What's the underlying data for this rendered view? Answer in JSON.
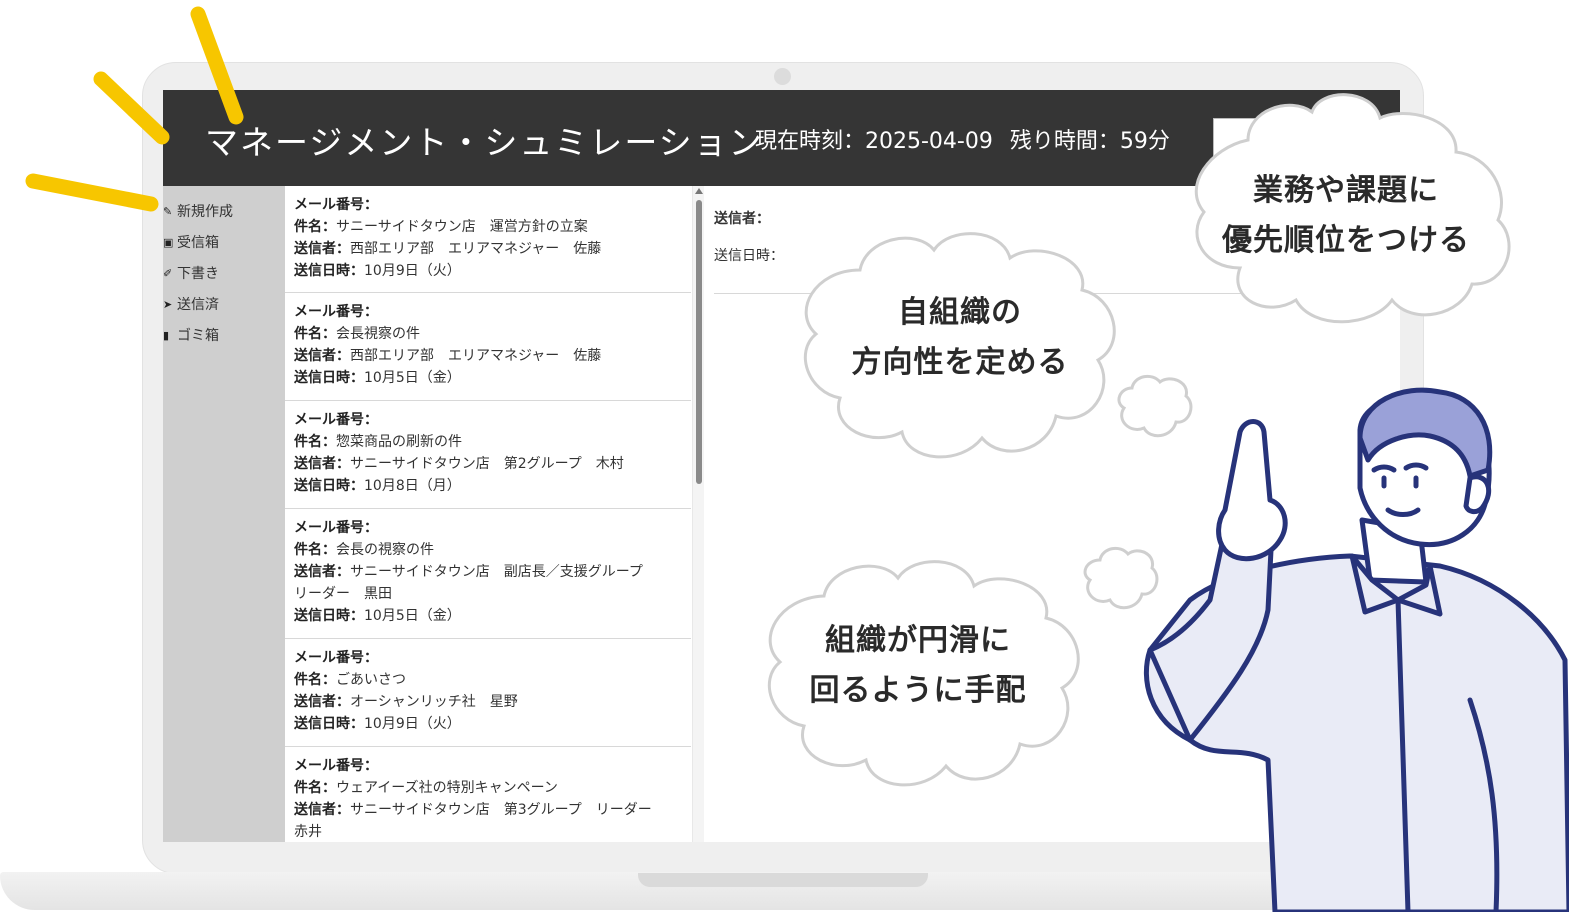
{
  "header": {
    "app_title": "マネージメント・シュミレーション",
    "current_time": "現在時刻：2025-04-09",
    "remaining_time": "残り時間：59分"
  },
  "sidebar": {
    "items": [
      {
        "label": "新規作成",
        "icon": "pencil-square-icon"
      },
      {
        "label": "受信箱",
        "icon": "inbox-icon"
      },
      {
        "label": "下書き",
        "icon": "pencil-icon"
      },
      {
        "label": "送信済",
        "icon": "send-icon"
      },
      {
        "label": "ゴミ箱",
        "icon": "trash-icon"
      }
    ]
  },
  "mail_list": {
    "labels": {
      "number": "メール番号：",
      "subject": "件名：",
      "sender": "送信者：",
      "date": "送信日時："
    },
    "items": [
      {
        "subject": "サニーサイドタウン店　運営方針の立案",
        "sender": "西部エリア部　エリアマネジャー　佐藤",
        "date": "10月9日（火）"
      },
      {
        "subject": "会長視察の件",
        "sender": "西部エリア部　エリアマネジャー　佐藤",
        "date": "10月5日（金）"
      },
      {
        "subject": "惣菜商品の刷新の件",
        "sender": "サニーサイドタウン店　第2グループ　木村",
        "date": "10月8日（月）"
      },
      {
        "subject": "会長の視察の件",
        "sender": "サニーサイドタウン店　副店長／支援グループ",
        "sender_cont": "リーダー　黒田",
        "date": "10月5日（金）"
      },
      {
        "subject": "ごあいさつ",
        "sender": "オーシャンリッチ社　星野",
        "date": "10月9日（火）"
      },
      {
        "subject": "ウェアイーズ社の特別キャンペーン",
        "sender": "サニーサイドタウン店　第3グループ　リーダー",
        "sender_cont": "赤井"
      }
    ]
  },
  "detail": {
    "sender_label": "送信者：",
    "date_label": "送信日時："
  },
  "bubbles": {
    "top_right": [
      "業務や課題に",
      "優先順位をつける"
    ],
    "middle": [
      "自組織の",
      "方向性を定める"
    ],
    "bottom": [
      "組織が円滑に",
      "回るように手配"
    ]
  },
  "colors": {
    "header_bg": "#353535",
    "sidebar_bg": "#cfcfcf",
    "accent_yellow": "#f7c600",
    "person_line": "#27337a",
    "person_hair": "#9aa1d8",
    "shirt": "#e9ebf6"
  }
}
